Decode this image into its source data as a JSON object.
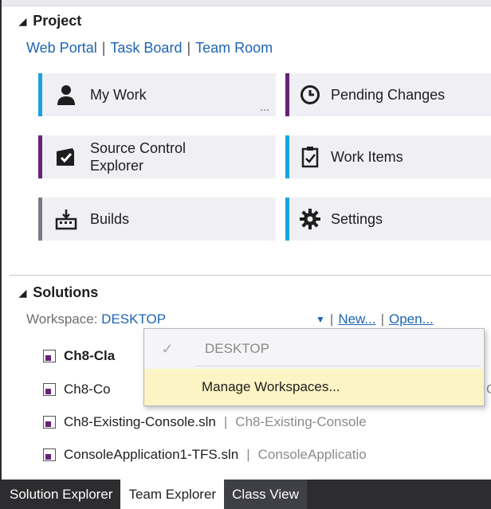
{
  "project": {
    "header": "Project",
    "links": [
      "Web Portal",
      "Task Board",
      "Team Room"
    ]
  },
  "tiles": [
    {
      "label": "My Work",
      "more": "...",
      "icon": "person-icon",
      "accent": "#1ba1e2"
    },
    {
      "label": "Pending Changes",
      "icon": "clock-icon",
      "accent": "#68217a"
    },
    {
      "label": "Source Control Explorer",
      "icon": "folder-check-icon",
      "accent": "#68217a"
    },
    {
      "label": "Work Items",
      "icon": "clipboard-check-icon",
      "accent": "#1ba1e2"
    },
    {
      "label": "Builds",
      "icon": "build-icon",
      "accent": "#7a7a86"
    },
    {
      "label": "Settings",
      "icon": "gear-icon",
      "accent": "#1ba1e2"
    }
  ],
  "solutions": {
    "header": "Solutions",
    "workspace_label": "Workspace: ",
    "workspace_value": "DESKTOP",
    "new_link": "New...",
    "open_link": "Open...",
    "rows": [
      {
        "name": "Ch8-Cla",
        "project": "",
        "bold": true
      },
      {
        "name": "Ch8-Co",
        "project": "C"
      },
      {
        "name": "Ch8-Existing-Console.sln",
        "project": "Ch8-Existing-Console"
      },
      {
        "name": "ConsoleApplication1-TFS.sln",
        "project": "ConsoleApplicatio"
      }
    ]
  },
  "dropdown": {
    "current": "DESKTOP",
    "checkmark": "✓",
    "manage": "Manage Workspaces..."
  },
  "tabs": [
    "Solution Explorer",
    "Team Explorer",
    "Class View"
  ],
  "colors": {
    "link": "#1e64b4",
    "accent_blue": "#1ba1e2",
    "accent_purple": "#68217a",
    "tab_bar": "#2d2d30"
  }
}
